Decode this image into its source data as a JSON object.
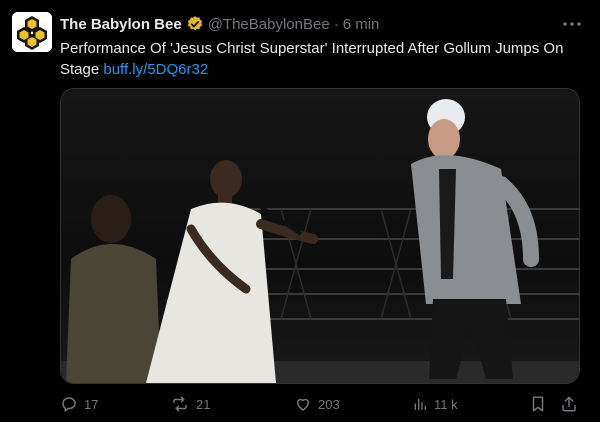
{
  "tweet": {
    "author_name": "The Babylon Bee",
    "handle": "@TheBabylonBee",
    "separator": "·",
    "time": "6 min",
    "text": "Performance Of 'Jesus Christ Superstar' Interrupted After Gollum Jumps On Stage",
    "link": "buff.ly/5DQ6r32"
  },
  "media": {
    "description_icon": "photo-of-stage-performance"
  },
  "actions": {
    "replies": "17",
    "reposts": "21",
    "likes": "203",
    "views": "11 k"
  },
  "colors": {
    "background": "#000000",
    "text": "#e7e9ea",
    "secondary": "#71767b",
    "link": "#1d9bf0",
    "verified_gold": "#e2b719"
  }
}
